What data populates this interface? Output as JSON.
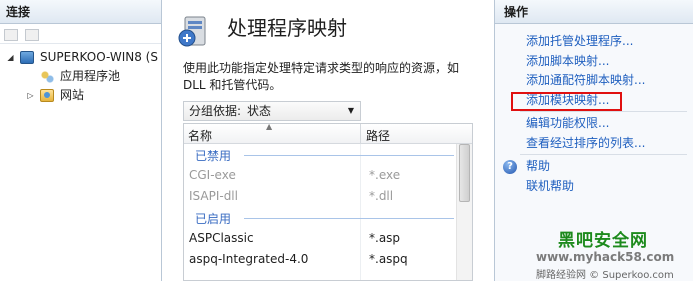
{
  "connections": {
    "title": "连接",
    "tree": [
      {
        "label": "SUPERKOO-WIN8 (S",
        "expander": "◢"
      },
      {
        "label": "应用程序池",
        "expander": ""
      },
      {
        "label": "网站",
        "expander": "▷"
      }
    ]
  },
  "feature": {
    "title": "处理程序映射",
    "description": "使用此功能指定处理特定请求类型的响应的资源，如 DLL 和托管代码。",
    "group_by": {
      "label": "分组依据:",
      "value": "状态"
    },
    "columns": [
      "名称",
      "路径"
    ],
    "groups": [
      {
        "label": "已禁用",
        "rows": [
          {
            "name": "CGI-exe",
            "path": "*.exe"
          },
          {
            "name": "ISAPI-dll",
            "path": "*.dll"
          }
        ]
      },
      {
        "label": "已启用",
        "rows": [
          {
            "name": "ASPClassic",
            "path": "*.asp"
          },
          {
            "name": "aspq-Integrated-4.0",
            "path": "*.aspq"
          }
        ]
      }
    ]
  },
  "actions": {
    "title": "操作",
    "group1": [
      "添加托管处理程序...",
      "添加脚本映射...",
      "添加通配符脚本映射...",
      "添加模块映射..."
    ],
    "group2": [
      "编辑功能权限...",
      "查看经过排序的列表..."
    ],
    "group3": [
      "帮助",
      "联机帮助"
    ],
    "highlight_color": "#e01010",
    "link_color": "#1f5fbf"
  },
  "watermark": {
    "brand": "黑吧安全网",
    "url": "www.myhack58.com",
    "caption": "脚路经验网 © Superkoo.com"
  }
}
